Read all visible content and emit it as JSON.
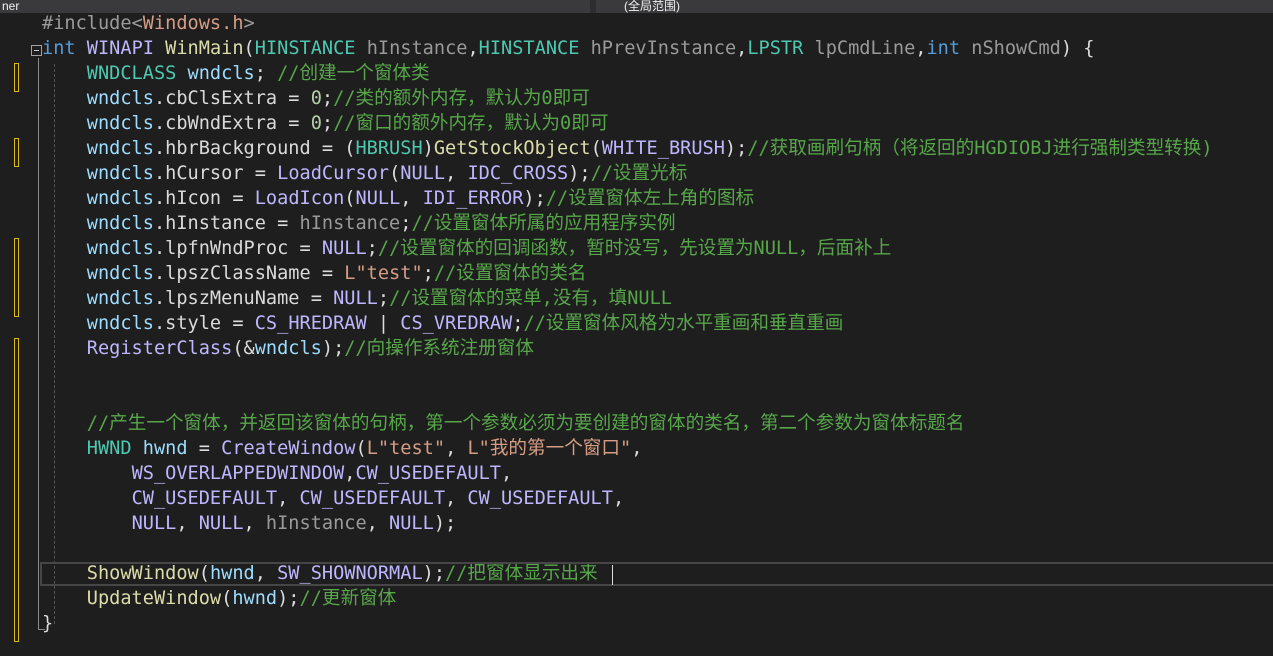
{
  "toolbar": {
    "left_dropdown": "ner",
    "right_dropdown": "(全局范围)"
  },
  "colors": {
    "background": "#1e1e1e",
    "keyword": "#569cd6",
    "type": "#4ec9b0",
    "function": "#dcdcaa",
    "macro": "#beb7ff",
    "local": "#9cdcfe",
    "comment": "#57a64a",
    "string": "#d69d85",
    "change_marker": "#d7ba14"
  },
  "change_markers": [
    [
      3,
      3
    ],
    [
      6,
      6
    ],
    [
      10,
      12
    ],
    [
      14,
      25
    ]
  ],
  "current_line": 23,
  "lines": [
    [
      [
        "pp",
        "#include"
      ],
      [
        "pp",
        "<"
      ],
      [
        "str",
        "Windows.h"
      ],
      [
        "pp",
        ">"
      ]
    ],
    [
      [
        "kw",
        "int"
      ],
      [
        "pl",
        " "
      ],
      [
        "mc",
        "WINAPI"
      ],
      [
        "pl",
        " "
      ],
      [
        "fn",
        "WinMain"
      ],
      [
        "pl",
        "("
      ],
      [
        "ty",
        "HINSTANCE"
      ],
      [
        "pl",
        " "
      ],
      [
        "pm",
        "hInstance"
      ],
      [
        "pl",
        ","
      ],
      [
        "ty",
        "HINSTANCE"
      ],
      [
        "pl",
        " "
      ],
      [
        "pm",
        "hPrevInstance"
      ],
      [
        "pl",
        ","
      ],
      [
        "ty",
        "LPSTR"
      ],
      [
        "pl",
        " "
      ],
      [
        "pm",
        "lpCmdLine"
      ],
      [
        "pl",
        ","
      ],
      [
        "kw",
        "int"
      ],
      [
        "pl",
        " "
      ],
      [
        "pm",
        "nShowCmd"
      ],
      [
        "pl",
        ") {"
      ]
    ],
    [
      [
        "pl",
        "    "
      ],
      [
        "ty",
        "WNDCLASS"
      ],
      [
        "pl",
        " "
      ],
      [
        "var",
        "wndcls"
      ],
      [
        "pl",
        "; "
      ],
      [
        "cm",
        "//创建一个窗体类"
      ]
    ],
    [
      [
        "pl",
        "    "
      ],
      [
        "var",
        "wndcls"
      ],
      [
        "pl",
        "."
      ],
      [
        "mem",
        "cbClsExtra"
      ],
      [
        "pl",
        " = "
      ],
      [
        "num",
        "0"
      ],
      [
        "pl",
        ";"
      ],
      [
        "cm",
        "//类的额外内存，默认为0即可"
      ]
    ],
    [
      [
        "pl",
        "    "
      ],
      [
        "var",
        "wndcls"
      ],
      [
        "pl",
        "."
      ],
      [
        "mem",
        "cbWndExtra"
      ],
      [
        "pl",
        " = "
      ],
      [
        "num",
        "0"
      ],
      [
        "pl",
        ";"
      ],
      [
        "cm",
        "//窗口的额外内存，默认为0即可"
      ]
    ],
    [
      [
        "pl",
        "    "
      ],
      [
        "var",
        "wndcls"
      ],
      [
        "pl",
        "."
      ],
      [
        "mem",
        "hbrBackground"
      ],
      [
        "pl",
        " = ("
      ],
      [
        "ty",
        "HBRUSH"
      ],
      [
        "pl",
        ")"
      ],
      [
        "fn",
        "GetStockObject"
      ],
      [
        "pl",
        "("
      ],
      [
        "mc",
        "WHITE_BRUSH"
      ],
      [
        "pl",
        ");"
      ],
      [
        "cm",
        "//获取画刷句柄（将返回的HGDIOBJ进行强制类型转换)"
      ]
    ],
    [
      [
        "pl",
        "    "
      ],
      [
        "var",
        "wndcls"
      ],
      [
        "pl",
        "."
      ],
      [
        "mem",
        "hCursor"
      ],
      [
        "pl",
        " = "
      ],
      [
        "mc",
        "LoadCursor"
      ],
      [
        "pl",
        "("
      ],
      [
        "mc",
        "NULL"
      ],
      [
        "pl",
        ", "
      ],
      [
        "mc",
        "IDC_CROSS"
      ],
      [
        "pl",
        ");"
      ],
      [
        "cm",
        "//设置光标"
      ]
    ],
    [
      [
        "pl",
        "    "
      ],
      [
        "var",
        "wndcls"
      ],
      [
        "pl",
        "."
      ],
      [
        "mem",
        "hIcon"
      ],
      [
        "pl",
        " = "
      ],
      [
        "mc",
        "LoadIcon"
      ],
      [
        "pl",
        "("
      ],
      [
        "mc",
        "NULL"
      ],
      [
        "pl",
        ", "
      ],
      [
        "mc",
        "IDI_ERROR"
      ],
      [
        "pl",
        ");"
      ],
      [
        "cm",
        "//设置窗体左上角的图标"
      ]
    ],
    [
      [
        "pl",
        "    "
      ],
      [
        "var",
        "wndcls"
      ],
      [
        "pl",
        "."
      ],
      [
        "mem",
        "hInstance"
      ],
      [
        "pl",
        " = "
      ],
      [
        "pm",
        "hInstance"
      ],
      [
        "pl",
        ";"
      ],
      [
        "cm",
        "//设置窗体所属的应用程序实例"
      ]
    ],
    [
      [
        "pl",
        "    "
      ],
      [
        "var",
        "wndcls"
      ],
      [
        "pl",
        "."
      ],
      [
        "mem",
        "lpfnWndProc"
      ],
      [
        "pl",
        " = "
      ],
      [
        "mc",
        "NULL"
      ],
      [
        "pl",
        ";"
      ],
      [
        "cm",
        "//设置窗体的回调函数，暂时没写，先设置为NULL，后面补上"
      ]
    ],
    [
      [
        "pl",
        "    "
      ],
      [
        "var",
        "wndcls"
      ],
      [
        "pl",
        "."
      ],
      [
        "mem",
        "lpszClassName"
      ],
      [
        "pl",
        " = "
      ],
      [
        "str",
        "L\"test\""
      ],
      [
        "pl",
        ";"
      ],
      [
        "cm",
        "//设置窗体的类名"
      ]
    ],
    [
      [
        "pl",
        "    "
      ],
      [
        "var",
        "wndcls"
      ],
      [
        "pl",
        "."
      ],
      [
        "mem",
        "lpszMenuName"
      ],
      [
        "pl",
        " = "
      ],
      [
        "mc",
        "NULL"
      ],
      [
        "pl",
        ";"
      ],
      [
        "cm",
        "//设置窗体的菜单,没有，填NULL"
      ]
    ],
    [
      [
        "pl",
        "    "
      ],
      [
        "var",
        "wndcls"
      ],
      [
        "pl",
        "."
      ],
      [
        "mem",
        "style"
      ],
      [
        "pl",
        " = "
      ],
      [
        "mc",
        "CS_HREDRAW"
      ],
      [
        "pl",
        " | "
      ],
      [
        "mc",
        "CS_VREDRAW"
      ],
      [
        "pl",
        ";"
      ],
      [
        "cm",
        "//设置窗体风格为水平重画和垂直重画"
      ]
    ],
    [
      [
        "pl",
        "    "
      ],
      [
        "mc",
        "RegisterClass"
      ],
      [
        "pl",
        "(&"
      ],
      [
        "var",
        "wndcls"
      ],
      [
        "pl",
        ");"
      ],
      [
        "cm",
        "//向操作系统注册窗体"
      ]
    ],
    [],
    [],
    [
      [
        "pl",
        "    "
      ],
      [
        "cm",
        "//产生一个窗体，并返回该窗体的句柄，第一个参数必须为要创建的窗体的类名，第二个参数为窗体标题名"
      ]
    ],
    [
      [
        "pl",
        "    "
      ],
      [
        "ty",
        "HWND"
      ],
      [
        "pl",
        " "
      ],
      [
        "var",
        "hwnd"
      ],
      [
        "pl",
        " = "
      ],
      [
        "mc",
        "CreateWindow"
      ],
      [
        "pl",
        "("
      ],
      [
        "str",
        "L\"test\""
      ],
      [
        "pl",
        ", "
      ],
      [
        "str",
        "L\"我的第一个窗口\""
      ],
      [
        "pl",
        ","
      ]
    ],
    [
      [
        "pl",
        "        "
      ],
      [
        "mc",
        "WS_OVERLAPPEDWINDOW"
      ],
      [
        "pl",
        ","
      ],
      [
        "mc",
        "CW_USEDEFAULT"
      ],
      [
        "pl",
        ","
      ]
    ],
    [
      [
        "pl",
        "        "
      ],
      [
        "mc",
        "CW_USEDEFAULT"
      ],
      [
        "pl",
        ", "
      ],
      [
        "mc",
        "CW_USEDEFAULT"
      ],
      [
        "pl",
        ", "
      ],
      [
        "mc",
        "CW_USEDEFAULT"
      ],
      [
        "pl",
        ","
      ]
    ],
    [
      [
        "pl",
        "        "
      ],
      [
        "mc",
        "NULL"
      ],
      [
        "pl",
        ", "
      ],
      [
        "mc",
        "NULL"
      ],
      [
        "pl",
        ", "
      ],
      [
        "pm",
        "hInstance"
      ],
      [
        "pl",
        ", "
      ],
      [
        "mc",
        "NULL"
      ],
      [
        "pl",
        ");"
      ]
    ],
    [],
    [
      [
        "pl",
        "    "
      ],
      [
        "fn",
        "ShowWindow"
      ],
      [
        "pl",
        "("
      ],
      [
        "var",
        "hwnd"
      ],
      [
        "pl",
        ", "
      ],
      [
        "mc",
        "SW_SHOWNORMAL"
      ],
      [
        "pl",
        ");"
      ],
      [
        "cm",
        "//把窗体显示出来"
      ]
    ],
    [
      [
        "pl",
        "    "
      ],
      [
        "fn",
        "UpdateWindow"
      ],
      [
        "pl",
        "("
      ],
      [
        "var",
        "hwnd"
      ],
      [
        "pl",
        ");"
      ],
      [
        "cm",
        "//更新窗体"
      ]
    ],
    [
      [
        "pl",
        "}"
      ]
    ]
  ]
}
